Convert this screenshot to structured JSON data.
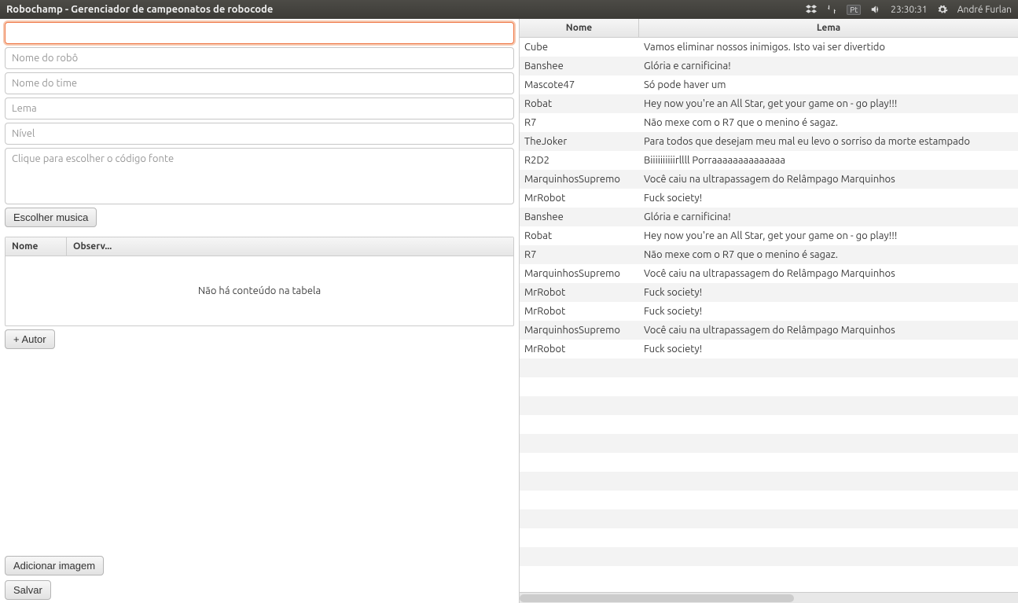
{
  "menubar": {
    "title": "Robochamp - Gerenciador de campeonatos de robocode",
    "lang": "Pt",
    "time": "23:30:31",
    "user": "André Furlan"
  },
  "form": {
    "field0_placeholder": "",
    "robot_name_placeholder": "Nome do robô",
    "team_name_placeholder": "Nome do time",
    "lema_placeholder": "Lema",
    "nivel_placeholder": "Nível",
    "source_placeholder": "Clique para escolher o código fonte",
    "choose_music_btn": "Escolher musica",
    "mini_table": {
      "col1": "Nome",
      "col2": "Observ...",
      "empty": "Não há conteúdo na tabela"
    },
    "add_author_btn": "+ Autor",
    "add_image_btn": "Adicionar imagem",
    "save_btn": "Salvar"
  },
  "table": {
    "col_nome": "Nome",
    "col_lema": "Lema",
    "rows": [
      {
        "nome": "Cube",
        "lema": "Vamos eliminar nossos inimigos. Isto vai ser divertido"
      },
      {
        "nome": "Banshee",
        "lema": "Glória e carnificina!"
      },
      {
        "nome": "Mascote47",
        "lema": "Só pode haver um"
      },
      {
        "nome": "Robat",
        "lema": "Hey now you're an All Star, get your game on - go play!!!"
      },
      {
        "nome": "R7",
        "lema": "Não mexe com o R7 que o menino é sagaz."
      },
      {
        "nome": "TheJoker",
        "lema": "Para todos que desejam meu mal eu levo o sorriso da morte estampado"
      },
      {
        "nome": "R2D2",
        "lema": "Biiiiiiiiiirllll Porraaaaaaaaaaaaaa"
      },
      {
        "nome": "MarquinhosSupremo",
        "lema": "Você caiu na ultrapassagem do Relâmpago Marquinhos"
      },
      {
        "nome": "MrRobot",
        "lema": "Fuck society!"
      },
      {
        "nome": "Banshee",
        "lema": "Glória e carnificina!"
      },
      {
        "nome": "Robat",
        "lema": "Hey now you're an All Star, get your game on - go play!!!"
      },
      {
        "nome": "R7",
        "lema": "Não mexe com o R7 que o menino é sagaz."
      },
      {
        "nome": "MarquinhosSupremo",
        "lema": "Você caiu na ultrapassagem do Relâmpago Marquinhos"
      },
      {
        "nome": "MrRobot",
        "lema": "Fuck society!"
      },
      {
        "nome": "MrRobot",
        "lema": "Fuck society!"
      },
      {
        "nome": "MarquinhosSupremo",
        "lema": "Você caiu na ultrapassagem do Relâmpago Marquinhos"
      },
      {
        "nome": "MrRobot",
        "lema": "Fuck society!"
      },
      {
        "nome": "",
        "lema": ""
      },
      {
        "nome": "",
        "lema": ""
      },
      {
        "nome": "",
        "lema": ""
      },
      {
        "nome": "",
        "lema": ""
      },
      {
        "nome": "",
        "lema": ""
      },
      {
        "nome": "",
        "lema": ""
      },
      {
        "nome": "",
        "lema": ""
      },
      {
        "nome": "",
        "lema": ""
      },
      {
        "nome": "",
        "lema": ""
      },
      {
        "nome": "",
        "lema": ""
      },
      {
        "nome": "",
        "lema": ""
      },
      {
        "nome": "",
        "lema": ""
      }
    ]
  }
}
